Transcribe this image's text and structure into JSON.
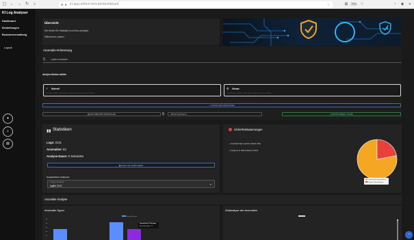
{
  "browser": {
    "url": "ki-app.admin-bsd.de/dashboard",
    "zoom": "70%"
  },
  "sidebar": {
    "app_title": "KI Log Analyser",
    "items": [
      {
        "label": "Dashboard"
      },
      {
        "label": "Einstellungen"
      },
      {
        "label": "Benutzerverwaltung"
      }
    ],
    "logout": "Logout"
  },
  "overview": {
    "title": "Übersicht",
    "line1": "Hier finden Sie Statistiken und Infos anzeigen.",
    "line2": "Willkommen, admin!"
  },
  "anomaly_detection": {
    "title": "Anomalie-Erkennung",
    "upload_label": "Logfile hochladen",
    "mode_label": "Analyse-Modus wählen",
    "modes": [
      {
        "title": "Schnell",
        "desc": "Schnelle Analyse mit einfacher Mustererkennung für kleine Dateien"
      },
      {
        "title": "Genau",
        "desc": "Tiefgehende Analyse – kann länger dauern bei großen Dateien"
      }
    ],
    "analyze_button": "ANOMALIEN ERKENNEN",
    "pdf_button": "PDF REPORT ERSTELLEN",
    "json_button": "JSON importieren",
    "export_button": "EXPORTIEREN (JSON)"
  },
  "stats": {
    "title": "Statistiken",
    "logs_label": "Logs:",
    "logs_value": "2131",
    "anomalies_label": "Anomalien:",
    "anomalies_value": "52",
    "duration_label": "Analyse-Dauer:",
    "duration_value": "0 Sekunden",
    "save_button": "ANALYSE SPEICHERN",
    "saved_label": "Gespeicherte Analysen:",
    "select_caption": "Analyse auswählen",
    "select_value": "logfile 2131"
  },
  "security": {
    "title": "Sicherheitswarnungen",
    "warnings": [
      {
        "text": "Potential SQL Injection Attack (4%)"
      },
      {
        "text": "Request to Risk Endpoint (XXX)"
      }
    ],
    "pie_legend": [
      {
        "label": "Potential SQL Injection Attack",
        "color": "#f5a623"
      },
      {
        "label": "Request to Risk Endpoint",
        "color": "#e8413c"
      }
    ]
  },
  "anomaly_analysis": {
    "title": "Anomalie Analyse",
    "types_chart_title": "Anomalie-Typen",
    "types_legend": "Anomalie-Typen",
    "tooltip_title": "Ausgeführte IP Anfrage",
    "tooltip_value": "Anomalie-Typen: 15",
    "timeline_title": "Zeitanalyse der Anomalien"
  },
  "colors": {
    "accent_blue": "#5b8dff",
    "accent_purple": "#8a2be2",
    "pie_orange": "#f5a623",
    "pie_red": "#e8413c"
  },
  "chart_data": [
    {
      "type": "pie",
      "categories": [
        "Potential SQL Injection Attack",
        "Request to Risk Endpoint"
      ],
      "values": [
        78,
        22
      ]
    },
    {
      "type": "bar",
      "title": "Anomalie-Typen",
      "series": [
        {
          "name": "Anomalie-Typen",
          "values": [
            8,
            13,
            8
          ]
        }
      ],
      "categories": [
        "",
        "",
        ""
      ]
    }
  ]
}
